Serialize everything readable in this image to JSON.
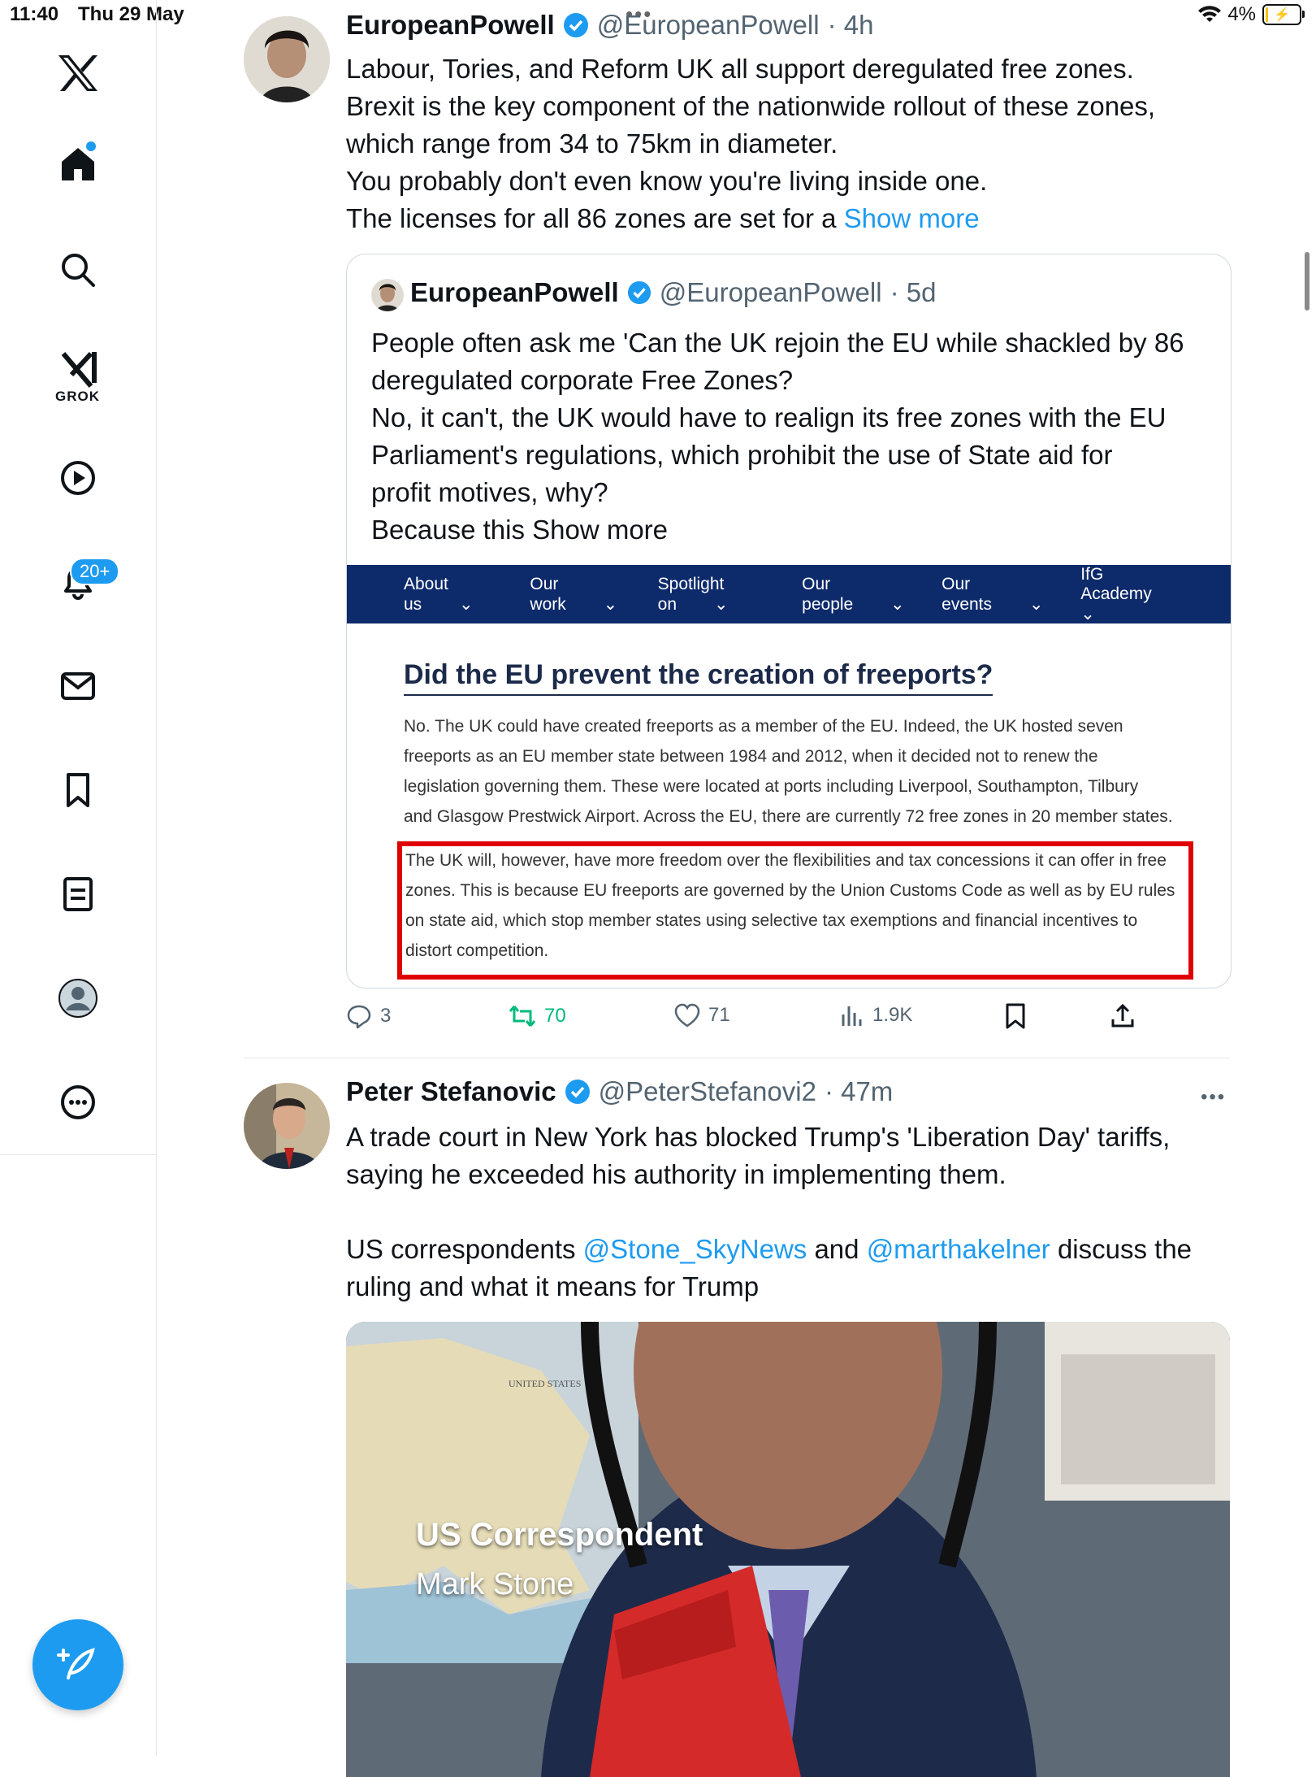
{
  "status_bar": {
    "time": "11:40",
    "date": "Thu 29 May",
    "battery": "4%"
  },
  "sidebar": {
    "grok_label": "GROK",
    "notifications_badge": "20+"
  },
  "tweet1": {
    "name": "EuropeanPowell",
    "handle": "@EuropeanPowell",
    "time": "· 4h",
    "lines": [
      "Labour, Tories, and Reform UK all support deregulated free zones.",
      "Brexit is the key component of the nationwide rollout of these zones,",
      "which range from 34 to 75km in diameter.",
      "You probably don't even know you're living inside one.",
      "The licenses for all 86 zones are set for a "
    ],
    "show_more": "Show more",
    "quote": {
      "name": "EuropeanPowell",
      "handle": "@EuropeanPowell",
      "time": "· 5d",
      "lines": [
        "People often ask me 'Can the UK rejoin the EU while shackled by 86",
        "deregulated corporate Free Zones?",
        "No, it can't, the UK would have to realign its free zones with the EU",
        "Parliament's regulations, which prohibit the use of State aid for",
        "profit motives, why?",
        "Because this Show more"
      ],
      "image": {
        "nav": [
          "About us",
          "Our work",
          "Spotlight on",
          "Our people",
          "Our events",
          "IfG Academy"
        ],
        "heading": "Did the EU prevent the creation of freeports?",
        "para1": [
          "No. The UK could have created freeports as a member of the EU. Indeed, the UK hosted seven",
          "freeports as an EU member state between 1984 and 2012, when it decided not to renew the",
          "legislation governing them. These were located at ports including Liverpool, Southampton, Tilbury",
          "and Glasgow Prestwick Airport. Across the EU, there are currently 72 free zones in 20 member states."
        ],
        "para2": [
          "The UK will, however, have more freedom over the flexibilities and tax concessions it can offer in free",
          "zones. This is because EU freeports are governed by the Union Customs Code as well as by EU rules",
          "on state aid, which stop member states using selective tax exemptions and financial incentives to",
          "distort competition."
        ]
      }
    },
    "actions": {
      "replies": "3",
      "reposts": "70",
      "likes": "71",
      "views": "1.9K"
    }
  },
  "tweet2": {
    "name": "Peter Stefanovic",
    "handle": "@PeterStefanovi2",
    "time": "· 47m",
    "line1": "A trade court in New York has blocked Trump's 'Liberation Day' tariffs,",
    "line2": "saying he exceeded his authority in implementing them.",
    "line3_pre": "US correspondents ",
    "mention1": "@Stone_SkyNews",
    "line3_mid": " and ",
    "mention2": "@marthakelner",
    "line3_post": " discuss the",
    "line4": "ruling and what it means for Trump",
    "video": {
      "caption_title": "US Correspondent",
      "caption_name": "Mark Stone",
      "map_label": "UNITED STATES"
    }
  },
  "colors": {
    "accent": "#1d9bf0",
    "repost_green": "#00ba7c",
    "ifg_navy": "#0d2a6b",
    "highlight_red": "#e00000"
  }
}
